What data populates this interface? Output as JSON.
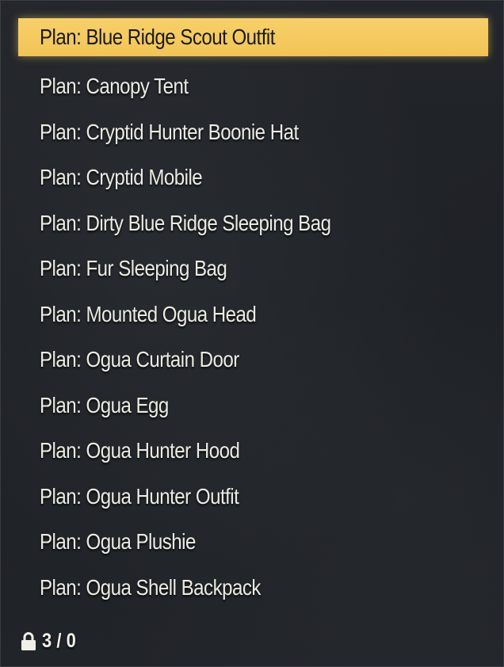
{
  "list": {
    "items": [
      {
        "label": "Plan: Blue Ridge Scout Outfit",
        "selected": true
      },
      {
        "label": "Plan: Canopy Tent",
        "selected": false
      },
      {
        "label": "Plan: Cryptid Hunter Boonie Hat",
        "selected": false
      },
      {
        "label": "Plan: Cryptid Mobile",
        "selected": false
      },
      {
        "label": "Plan: Dirty Blue Ridge Sleeping Bag",
        "selected": false
      },
      {
        "label": "Plan: Fur Sleeping Bag",
        "selected": false
      },
      {
        "label": "Plan: Mounted Ogua Head",
        "selected": false
      },
      {
        "label": "Plan: Ogua Curtain Door",
        "selected": false
      },
      {
        "label": "Plan: Ogua Egg",
        "selected": false
      },
      {
        "label": "Plan: Ogua Hunter Hood",
        "selected": false
      },
      {
        "label": "Plan: Ogua Hunter Outfit",
        "selected": false
      },
      {
        "label": "Plan: Ogua Plushie",
        "selected": false
      },
      {
        "label": "Plan: Ogua Shell Backpack",
        "selected": false
      }
    ]
  },
  "footer": {
    "icon": "lock-icon",
    "capacity": "3 / 0"
  },
  "colors": {
    "highlight": "#f2c456",
    "text": "#ecebe3",
    "background": "#1c1f23"
  }
}
